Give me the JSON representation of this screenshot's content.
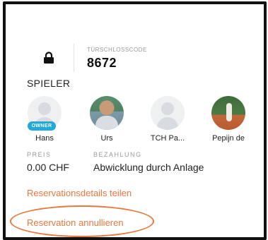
{
  "lock": {
    "icon": "lock-icon",
    "label": "TÜRSCHLOSSCODE",
    "code": "8672"
  },
  "players": {
    "title": "SPIELER",
    "items": [
      {
        "name": "Hans",
        "badge": "OWNER",
        "avatar": "placeholder"
      },
      {
        "name": "Urs",
        "avatar": "photo"
      },
      {
        "name": "TCH Pa...",
        "avatar": "placeholder"
      },
      {
        "name": "Pepijn de",
        "avatar": "photo"
      }
    ]
  },
  "price": {
    "label": "PREIS",
    "value": "0.00 CHF"
  },
  "payment": {
    "label": "BEZAHLUNG",
    "value": "Abwicklung durch Anlage"
  },
  "actions": {
    "share_label": "Reservationsdetails teilen",
    "cancel_label": "Reservation annullieren"
  },
  "colors": {
    "accent": "#e8773f",
    "badge": "#21a9d9",
    "frame": "#111111"
  }
}
